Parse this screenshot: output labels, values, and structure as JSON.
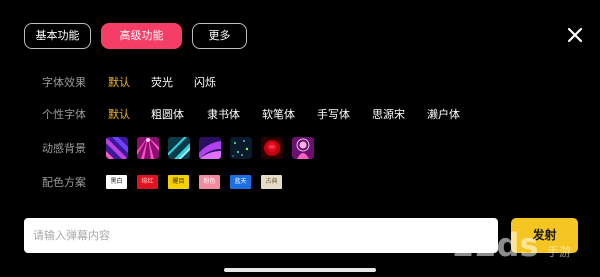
{
  "tabs": [
    {
      "label": "基本功能",
      "active": false
    },
    {
      "label": "高级功能",
      "active": true
    },
    {
      "label": "更多",
      "active": false
    }
  ],
  "rows": {
    "font_effect": {
      "label": "字体效果",
      "options": [
        "默认",
        "荧光",
        "闪烁"
      ],
      "selected": 0
    },
    "personal_font": {
      "label": "个性字体",
      "options": [
        "默认",
        "粗圆体",
        "隶书体",
        "软笔体",
        "手写体",
        "思源宋",
        "濑户体"
      ],
      "selected": 0
    },
    "dynamic_bg": {
      "label": "动感背景",
      "items": [
        "purple-diagonal",
        "pink-rays",
        "teal-stripes",
        "violet-wave",
        "dark-sparkles",
        "red-rose",
        "pink-figure"
      ]
    },
    "color_scheme": {
      "label": "配色方案",
      "swatches": [
        {
          "label": "黑白",
          "bg": "#ffffff",
          "fg": "#111111"
        },
        {
          "label": "绯红",
          "bg": "#e0141e",
          "fg": "#ffd2d2"
        },
        {
          "label": "醒目",
          "bg": "#f5d000",
          "fg": "#3a2a00"
        },
        {
          "label": "粉色",
          "bg": "#f28aa0",
          "fg": "#ffffff"
        },
        {
          "label": "蓝天",
          "bg": "#1d6fe0",
          "fg": "#ffffff"
        },
        {
          "label": "古典",
          "bg": "#e6dcc6",
          "fg": "#6b5a3a"
        }
      ]
    }
  },
  "input": {
    "placeholder": "请输入弹幕内容"
  },
  "send_label": "发射",
  "watermark": {
    "text": "22ds",
    "sub": "手游"
  },
  "colors": {
    "accent": "#f53d66",
    "selected_text": "#f2b81c",
    "send_button": "#f5c623"
  }
}
